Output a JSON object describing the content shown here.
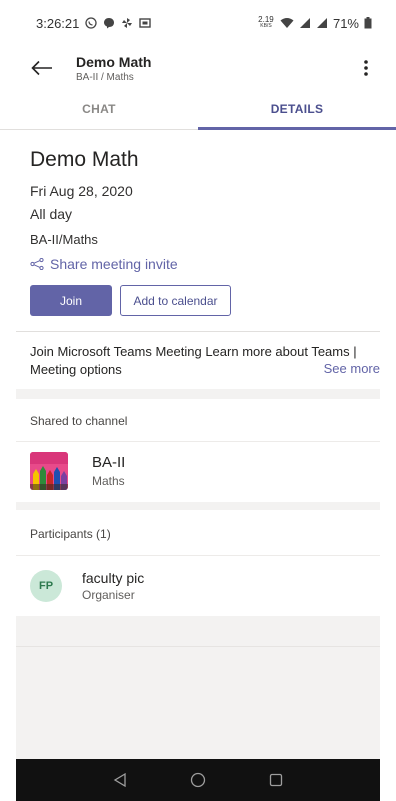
{
  "status_bar": {
    "time": "3:26:21",
    "net_speed": "2.19",
    "net_unit": "KB/S",
    "battery": "71%"
  },
  "header": {
    "title": "Demo Math",
    "subtitle": "BA-II / Maths"
  },
  "tabs": [
    {
      "label": "CHAT",
      "active": false
    },
    {
      "label": "DETAILS",
      "active": true
    }
  ],
  "meeting": {
    "title": "Demo Math",
    "date": "Fri Aug 28, 2020",
    "time": "All day",
    "channel": "BA-II/Maths",
    "share_label": "Share meeting invite",
    "join_label": "Join",
    "calendar_label": "Add to calendar",
    "description": "Join Microsoft Teams Meeting Learn more about Teams | Meeting options",
    "see_more_label": "See more"
  },
  "shared": {
    "header": "Shared to channel",
    "team": "BA-II",
    "channel": "Maths"
  },
  "participants": {
    "header": "Participants (1)",
    "items": [
      {
        "initials": "FP",
        "name": "faculty pic",
        "role": "Organiser"
      }
    ]
  },
  "colors": {
    "accent": "#6264a7",
    "avatar_bg": "#cbe8d8",
    "avatar_fg": "#2e7a4f"
  }
}
